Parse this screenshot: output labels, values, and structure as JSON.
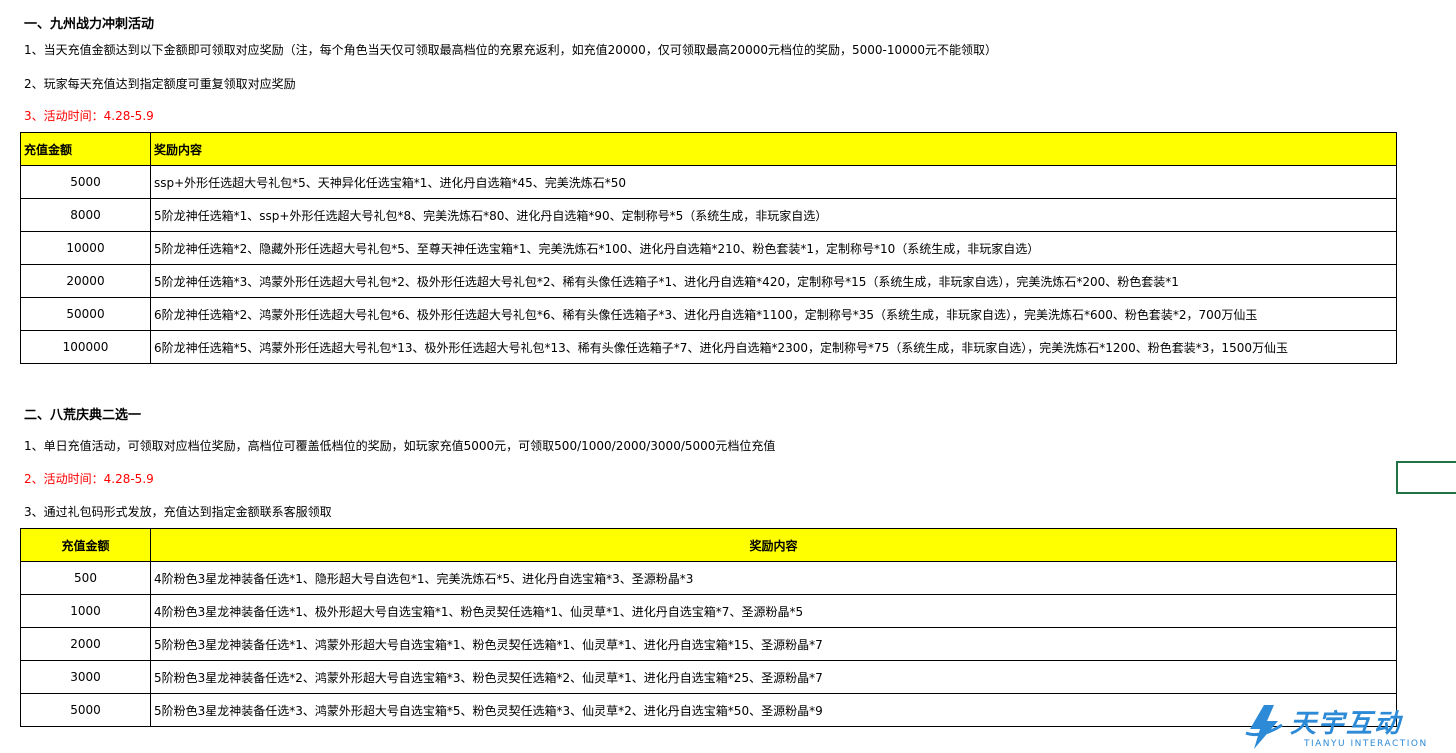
{
  "section1": {
    "title": "一、九州战力冲刺活动",
    "line1": "1、当天充值金额达到以下金额即可领取对应奖励（注，每个角色当天仅可领取最高档位的充累充返利，如充值20000，仅可领取最高20000元档位的奖励，5000-10000元不能领取）",
    "line2": "2、玩家每天充值达到指定额度可重复领取对应奖励",
    "line3": "3、活动时间：4.28-5.9",
    "headers": [
      "充值金额",
      "奖励内容"
    ],
    "rows": [
      [
        "5000",
        "ssp+外形任选超大号礼包*5、天神异化任选宝箱*1、进化丹自选箱*45、完美洗炼石*50"
      ],
      [
        "8000",
        "5阶龙神任选箱*1、ssp+外形任选超大号礼包*8、完美洗炼石*80、进化丹自选箱*90、定制称号*5（系统生成，非玩家自选）"
      ],
      [
        "10000",
        "5阶龙神任选箱*2、隐藏外形任选超大号礼包*5、至尊天神任选宝箱*1、完美洗炼石*100、进化丹自选箱*210、粉色套装*1，定制称号*10（系统生成，非玩家自选）"
      ],
      [
        "20000",
        "5阶龙神任选箱*3、鸿蒙外形任选超大号礼包*2、极外形任选超大号礼包*2、稀有头像任选箱子*1、进化丹自选箱*420，定制称号*15（系统生成，非玩家自选），完美洗炼石*200、粉色套装*1"
      ],
      [
        "50000",
        "6阶龙神任选箱*2、鸿蒙外形任选超大号礼包*6、极外形任选超大号礼包*6、稀有头像任选箱子*3、进化丹自选箱*1100，定制称号*35（系统生成，非玩家自选），完美洗炼石*600、粉色套装*2，700万仙玉"
      ],
      [
        "100000",
        "6阶龙神任选箱*5、鸿蒙外形任选超大号礼包*13、极外形任选超大号礼包*13、稀有头像任选箱子*7、进化丹自选箱*2300，定制称号*75（系统生成，非玩家自选），完美洗炼石*1200、粉色套装*3，1500万仙玉"
      ]
    ]
  },
  "section2": {
    "title": "二、八荒庆典二选一",
    "line1": "1、单日充值活动，可领取对应档位奖励，高档位可覆盖低档位的奖励，如玩家充值5000元，可领取500/1000/2000/3000/5000元档位充值",
    "line2": "2、活动时间：4.28-5.9",
    "line3": "3、通过礼包码形式发放，充值达到指定金额联系客服领取",
    "headers": [
      "充值金额",
      "奖励内容"
    ],
    "rows": [
      [
        "500",
        "4阶粉色3星龙神装备任选*1、隐形超大号自选包*1、完美洗炼石*5、进化丹自选宝箱*3、圣源粉晶*3"
      ],
      [
        "1000",
        "4阶粉色3星龙神装备任选*1、极外形超大号自选宝箱*1、粉色灵契任选箱*1、仙灵草*1、进化丹自选宝箱*7、圣源粉晶*5"
      ],
      [
        "2000",
        "5阶粉色3星龙神装备任选*1、鸿蒙外形超大号自选宝箱*1、粉色灵契任选箱*1、仙灵草*1、进化丹自选宝箱*15、圣源粉晶*7"
      ],
      [
        "3000",
        "5阶粉色3星龙神装备任选*2、鸿蒙外形超大号自选宝箱*3、粉色灵契任选箱*2、仙灵草*1、进化丹自选宝箱*25、圣源粉晶*7"
      ],
      [
        "5000",
        "5阶粉色3星龙神装备任选*3、鸿蒙外形超大号自选宝箱*5、粉色灵契任选箱*3、仙灵草*2、进化丹自选宝箱*50、圣源粉晶*9"
      ]
    ]
  },
  "watermark": {
    "name": "天宇互动",
    "sub": "TIANYU INTERACTION"
  },
  "colors": {
    "header_fill": "#ffff00",
    "red_text": "#ff0000",
    "selection": "#217346",
    "logo": "#2d8ad6"
  }
}
